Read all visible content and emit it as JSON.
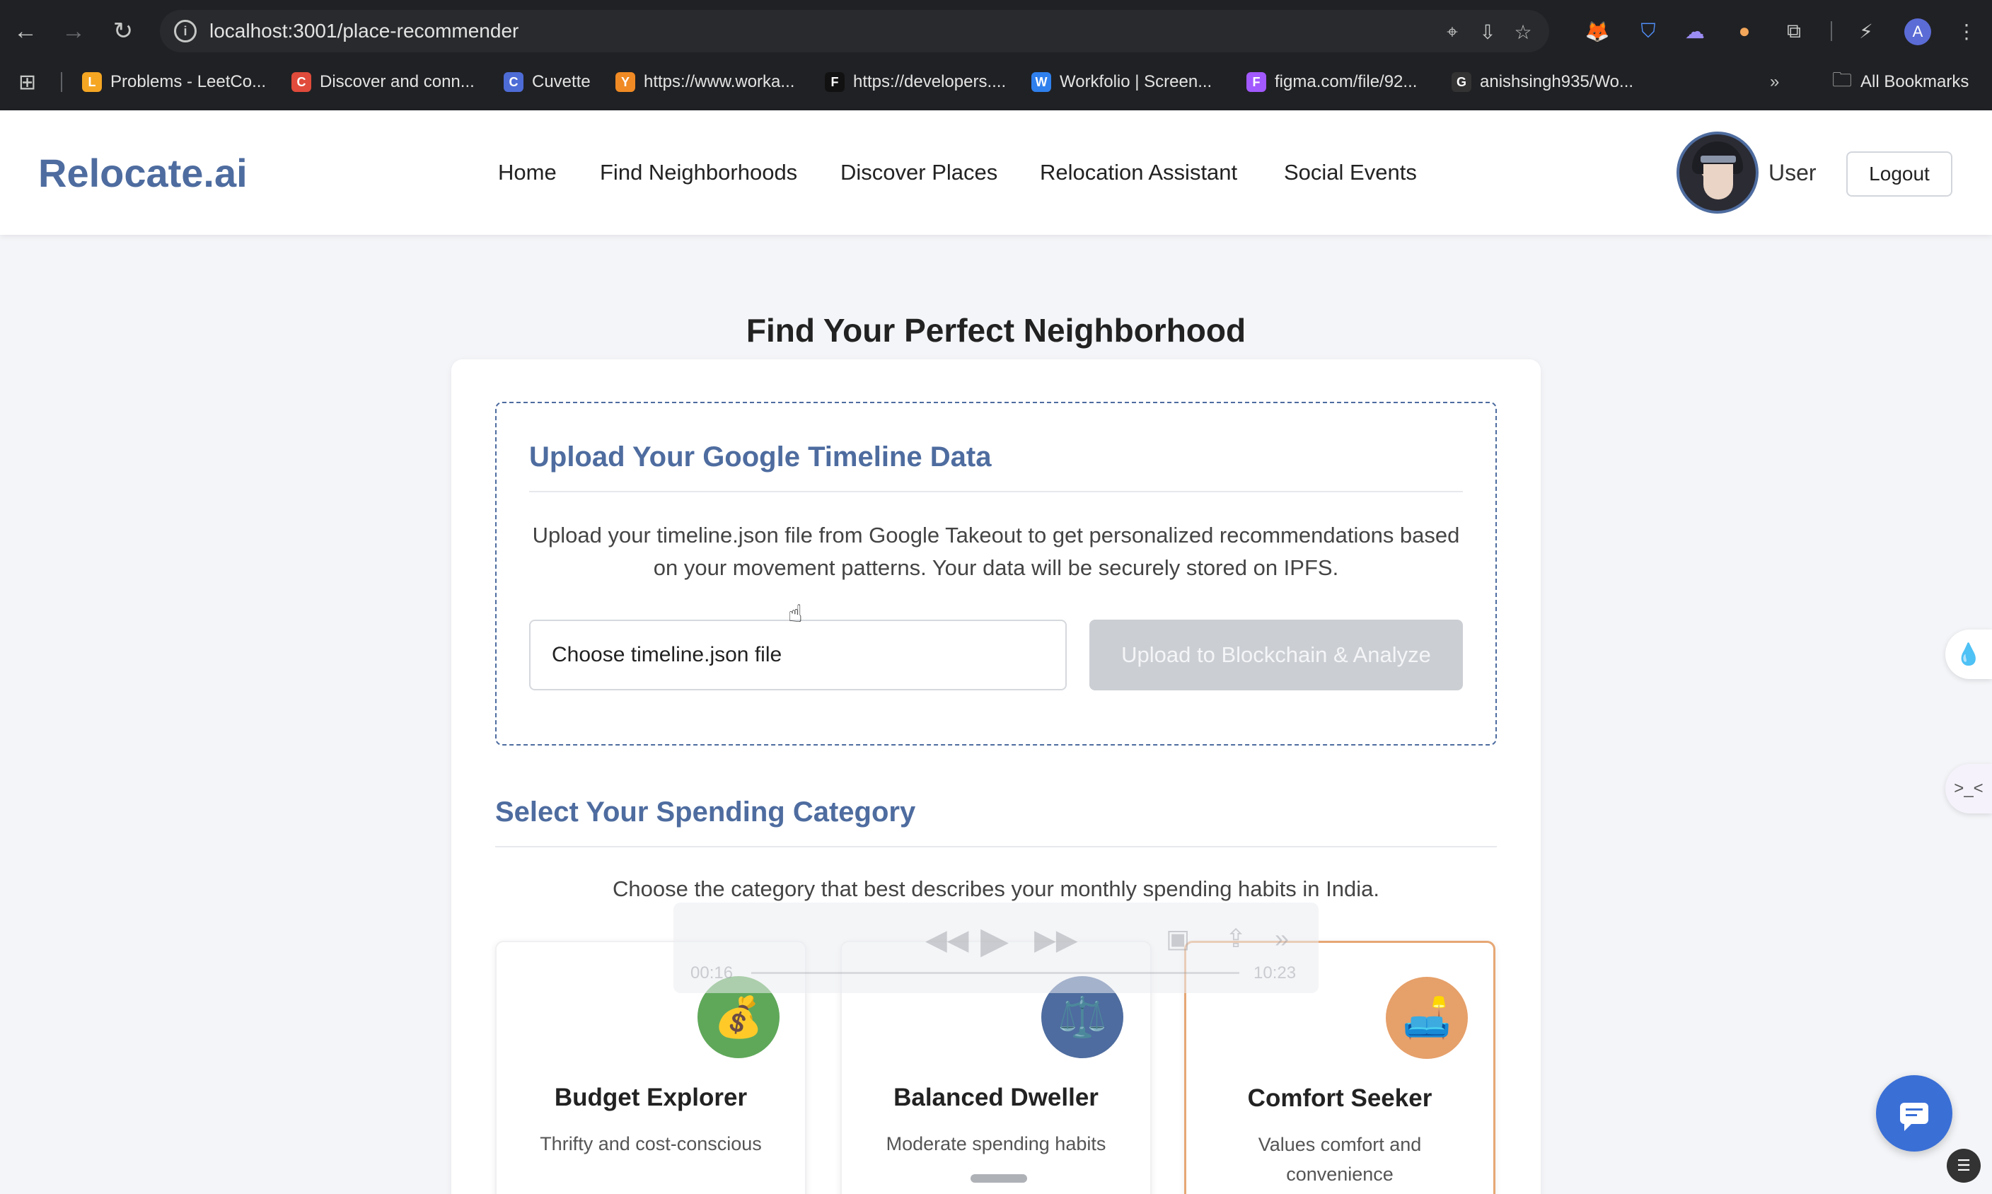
{
  "browser": {
    "url": "localhost:3001/place-recommender",
    "bookmarks": [
      {
        "label": "Problems - LeetCo...",
        "color": "#f5a623",
        "glyph": "L"
      },
      {
        "label": "Discover and conn...",
        "color": "#e04b3b",
        "glyph": "C"
      },
      {
        "label": "Cuvette",
        "color": "#4e6cd6",
        "glyph": "C"
      },
      {
        "label": "https://www.worka...",
        "color": "#f08a24",
        "glyph": "Y"
      },
      {
        "label": "https://developers....",
        "color": "#111111",
        "glyph": "F"
      },
      {
        "label": "Workfolio | Screen...",
        "color": "#2f80ed",
        "glyph": "W"
      },
      {
        "label": "figma.com/file/92...",
        "color": "#a259ff",
        "glyph": "F"
      },
      {
        "label": "anishsingh935/Wo...",
        "color": "#333333",
        "glyph": "G"
      }
    ],
    "all_bookmarks": "All Bookmarks",
    "profile_initial": "A"
  },
  "header": {
    "logo": "Relocate.ai",
    "nav": [
      "Home",
      "Find Neighborhoods",
      "Discover Places",
      "Relocation Assistant",
      "Social Events"
    ],
    "user_name": "User",
    "logout_label": "Logout"
  },
  "main": {
    "page_title": "Find Your Perfect Neighborhood",
    "upload": {
      "heading": "Upload Your Google Timeline Data",
      "description": "Upload your timeline.json file from Google Takeout to get personalized recommendations based on your movement patterns. Your data will be securely stored on IPFS.",
      "file_input_label": "Choose timeline.json file",
      "upload_button": "Upload to Blockchain & Analyze"
    },
    "spending": {
      "heading": "Select Your Spending Category",
      "description": "Choose the category that best describes your monthly spending habits in India.",
      "categories": [
        {
          "title": "Budget Explorer",
          "subtitle": "Thrifty and cost-conscious",
          "icon": "money-bag-icon",
          "color": "#5fa85a",
          "glyph": "💰"
        },
        {
          "title": "Balanced Dweller",
          "subtitle": "Moderate spending habits",
          "icon": "scales-icon",
          "color": "#4e6c9f",
          "glyph": "⚖️"
        },
        {
          "title": "Comfort Seeker",
          "subtitle": "Values comfort and convenience",
          "icon": "couch-icon",
          "color": "#e6a06a",
          "glyph": "🛋️",
          "selected": true
        }
      ]
    }
  },
  "media_overlay": {
    "time_elapsed": "00:16",
    "time_total": "10:23"
  },
  "colors": {
    "accent": "#4e6c9f",
    "selected_border": "#e6a774",
    "chat_button": "#3a6fd6"
  }
}
